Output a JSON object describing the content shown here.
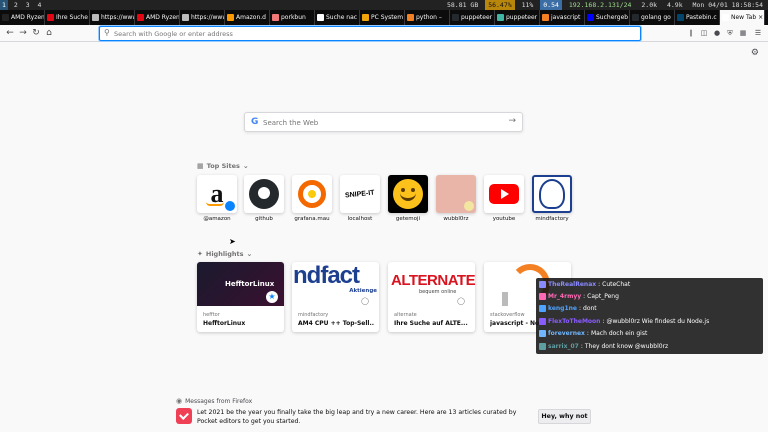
{
  "statusbar": {
    "workspaces": [
      "1",
      "2",
      "3",
      "4"
    ],
    "disk": "58.81 GB",
    "cpu": "56.47%",
    "mem": "11%",
    "load": "0.54",
    "ip": "192.168.2.131/24",
    "net_down": "2.0k",
    "net_up": "4.9k",
    "datetime": "Mon 04/01 18:58:54"
  },
  "tabs": [
    {
      "label": "AMD Ryzen",
      "color": "#222222"
    },
    {
      "label": "Ihre Suche",
      "color": "#e30613"
    },
    {
      "label": "https://www.",
      "color": "#bbbbbb"
    },
    {
      "label": "AMD Ryzen",
      "color": "#e30613"
    },
    {
      "label": "https://www.",
      "color": "#bbbbbb"
    },
    {
      "label": "Amazon.d",
      "color": "#ff9900"
    },
    {
      "label": "porkbun",
      "color": "#f27777"
    },
    {
      "label": "Suche nac",
      "color": "#ffffff"
    },
    {
      "label": "PC System",
      "color": "#f0a30a"
    },
    {
      "label": "python –",
      "color": "#f48024"
    },
    {
      "label": "puppeteer",
      "color": "#24292e"
    },
    {
      "label": "puppeteer",
      "color": "#40b5a4"
    },
    {
      "label": "javascript",
      "color": "#f48024"
    },
    {
      "label": "Suchergeb",
      "color": "#0000ff"
    },
    {
      "label": "golang go",
      "color": "#24292e"
    },
    {
      "label": "Pastebin.c",
      "color": "#02456c"
    },
    {
      "label": "New Tab",
      "color": "#ffffff",
      "active": true
    }
  ],
  "urlbar": {
    "placeholder": "Search with Google or enter address"
  },
  "websearch": {
    "placeholder": "Search the Web"
  },
  "topsites": {
    "title": "Top Sites",
    "items": [
      {
        "label": "@amazon"
      },
      {
        "label": "github"
      },
      {
        "label": "grafana.mau"
      },
      {
        "label": "localhost"
      },
      {
        "label": "getemoji"
      },
      {
        "label": "wubbl0rz"
      },
      {
        "label": "youtube"
      },
      {
        "label": "mindfactory"
      }
    ]
  },
  "highlights": {
    "title": "Highlights",
    "items": [
      {
        "source": "hefftor",
        "title": "HefftorLinux",
        "image_text": "HefftorLinux"
      },
      {
        "source": "mindfactory",
        "title": "AM4 CPU ++ Top-Sell...",
        "image_text": "ndfact",
        "image_sub": "Aktienge"
      },
      {
        "source": "alternate",
        "title": "Ihre Suche auf ALTE...",
        "image_text": "ALTERNATE",
        "image_sub": "bequem online"
      },
      {
        "source": "stackoverflow",
        "title": "javascript - No"
      }
    ]
  },
  "localhost_tile_text": "SNIPE-IT",
  "chat": [
    {
      "user": "TheRealRenax",
      "user_color": "#8a8aff",
      "msg": "CuteChat"
    },
    {
      "user": "Mr_4rmyy",
      "user_color": "#ff69b4",
      "msg": "Capt_Peng"
    },
    {
      "user": "keng1ne",
      "user_color": "#4fa3ff",
      "msg": "dont"
    },
    {
      "user": "FlexToTheMoon",
      "user_color": "#8a5cff",
      "msg": "@wubbl0rz Wie findest du Node.js"
    },
    {
      "user": "forevernex",
      "user_color": "#6fb6ff",
      "msg": "Mach doch ein gist"
    },
    {
      "user": "sarrix_07",
      "user_color": "#5f9ea0",
      "msg": "They dont know   @wubbl0rz"
    }
  ],
  "messages": {
    "title": "Messages from Firefox",
    "text": "Let 2021 be the year you finally take the big leap and try a new career. Here are 13 articles curated by Pocket editors to get you started.",
    "button": "Hey, why not"
  }
}
